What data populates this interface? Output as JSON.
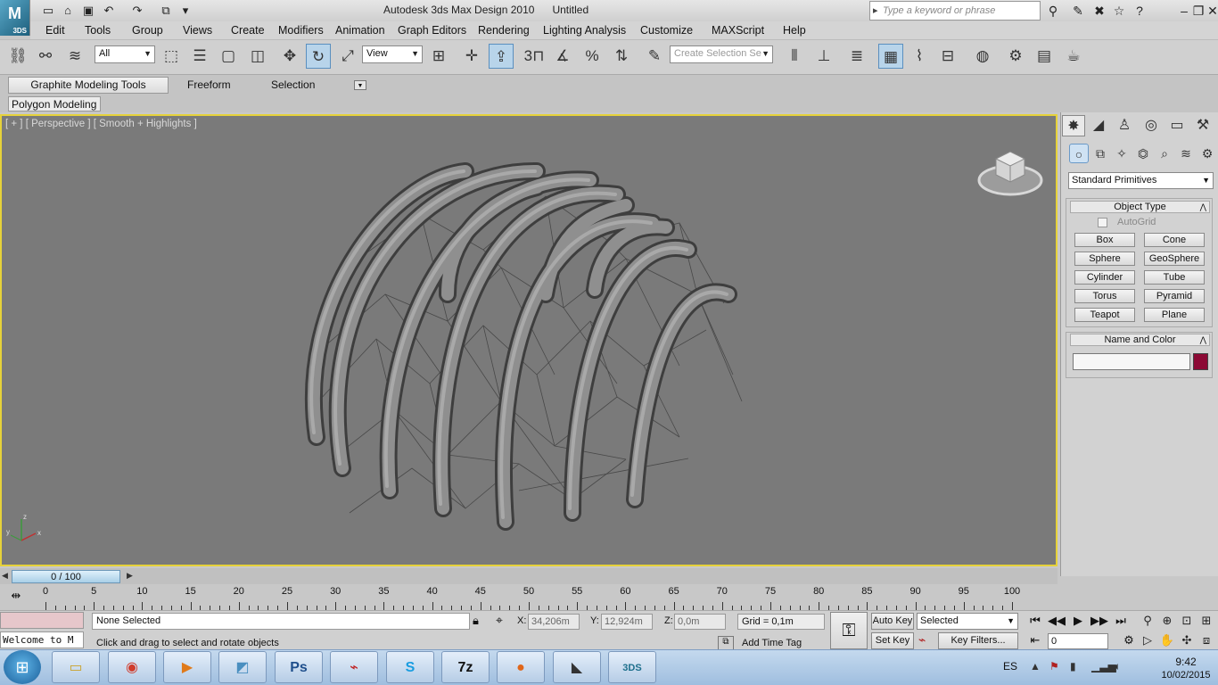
{
  "window": {
    "title": "Autodesk 3ds Max Design 2010      Untitled",
    "logo_text": "3DS"
  },
  "help_search": {
    "placeholder": "Type a keyword or phrase"
  },
  "menu": [
    "Edit",
    "Tools",
    "Group",
    "Views",
    "Create",
    "Modifiers",
    "Animation",
    "Graph Editors",
    "Rendering",
    "Lighting Analysis",
    "Customize",
    "MAXScript",
    "Help"
  ],
  "toolbar": {
    "filter": "All",
    "ref_coord": "View",
    "named_selection_placeholder": "Create Selection Se",
    "snap_label": "3"
  },
  "ribbon": {
    "tabs": [
      "Graphite Modeling Tools",
      "Freeform",
      "Selection"
    ],
    "panel": "Polygon Modeling"
  },
  "viewport": {
    "label": "[ + ] [ Perspective ] [ Smooth + Highlights ]",
    "axes": {
      "x": "x",
      "y": "y",
      "z": "z"
    }
  },
  "command_panel": {
    "category": "Standard Primitives",
    "object_type_title": "Object Type",
    "autogrid": "AutoGrid",
    "primitives": [
      "Box",
      "Cone",
      "Sphere",
      "GeoSphere",
      "Cylinder",
      "Tube",
      "Torus",
      "Pyramid",
      "Teapot",
      "Plane"
    ],
    "name_color_title": "Name and Color",
    "swatch_color": "#8c0a35"
  },
  "timeline": {
    "slider": "0 / 100",
    "ticks": [
      0,
      5,
      10,
      15,
      20,
      25,
      30,
      35,
      40,
      45,
      50,
      55,
      60,
      65,
      70,
      75,
      80,
      85,
      90,
      95,
      100
    ]
  },
  "status": {
    "maxscript": "Welcome to M",
    "selection": "None Selected",
    "prompt": "Click and drag to select and rotate objects",
    "x_label": "X:",
    "x": "34,206m",
    "y_label": "Y:",
    "y": "12,924m",
    "z_label": "Z:",
    "z": "0,0m",
    "grid": "Grid = 0,1m",
    "add_time_tag": "Add Time Tag",
    "auto_key": "Auto Key",
    "set_key": "Set Key",
    "selected": "Selected",
    "key_filters": "Key Filters...",
    "frame": "0"
  },
  "taskbar": {
    "lang": "ES",
    "time": "9:42",
    "date": "10/02/2015",
    "apps": [
      "folder-icon",
      "chrome-icon",
      "media-player-icon",
      "sketch-icon",
      "photoshop-icon",
      "acrobat-icon",
      "skype-icon",
      "7zip-icon",
      "firefox-icon",
      "rhino-icon",
      "3dsmax-icon"
    ],
    "app_labels": {
      "photoshop": "Ps",
      "sevenzip": "7z",
      "max": "3DS"
    }
  }
}
